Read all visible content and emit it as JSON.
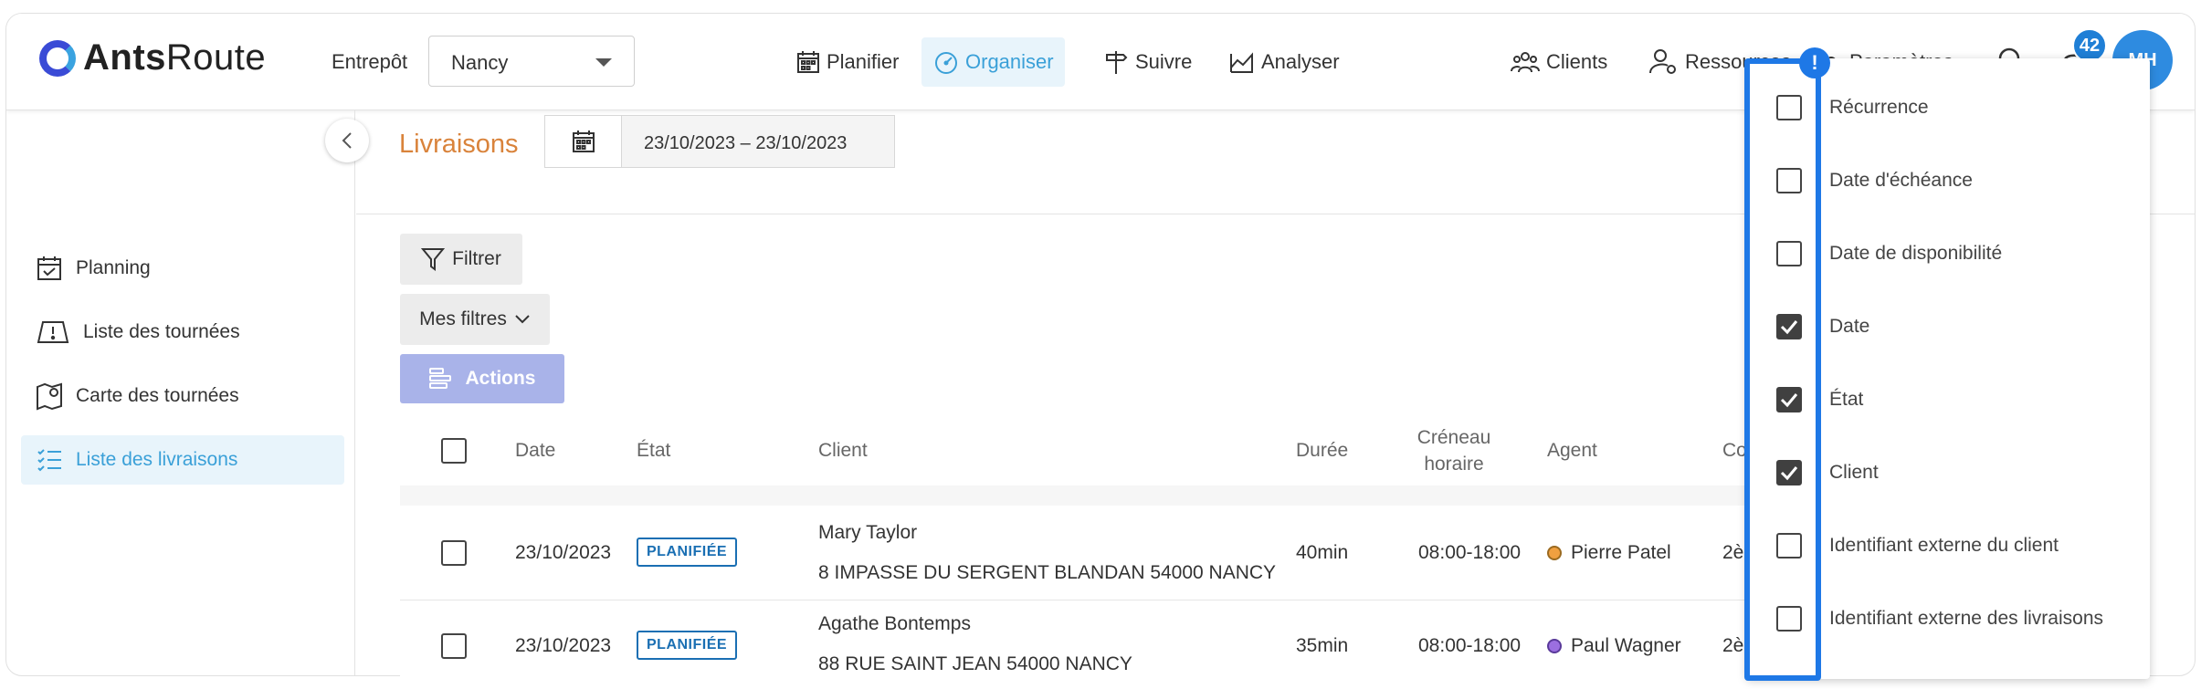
{
  "app": {
    "logo_bold": "Ants",
    "logo_rest": "Route"
  },
  "warehouse": {
    "label": "Entrepôt",
    "value": "Nancy"
  },
  "nav": {
    "planifier": "Planifier",
    "organiser": "Organiser",
    "suivre": "Suivre",
    "analyser": "Analyser",
    "clients": "Clients",
    "ressources": "Ressources",
    "parametres": "Paramètres"
  },
  "notifications": {
    "count": "42"
  },
  "user": {
    "initials": "MH"
  },
  "sidebar": {
    "items": [
      {
        "label": "Planning",
        "icon": "calendar-check-icon"
      },
      {
        "label": "Liste des tournées",
        "icon": "route-board-icon"
      },
      {
        "label": "Carte des tournées",
        "icon": "map-pin-icon"
      },
      {
        "label": "Liste des livraisons",
        "icon": "checklist-icon"
      }
    ]
  },
  "page": {
    "title": "Livraisons",
    "date_range": "23/10/2023 – 23/10/2023"
  },
  "toolbar": {
    "filter": "Filtrer",
    "my_filters": "Mes filtres",
    "actions": "Actions"
  },
  "table": {
    "headers": {
      "date": "Date",
      "etat": "État",
      "client": "Client",
      "duree": "Durée",
      "creneau_1": "Créneau",
      "creneau_2": "horaire",
      "agent": "Agent",
      "col_partial": "Co"
    },
    "rows": [
      {
        "date": "23/10/2023",
        "status": "PLANIFIÉE",
        "client_name": "Mary Taylor",
        "client_address": "8 IMPASSE DU SERGENT BLANDAN 54000 NANCY",
        "duration": "40min",
        "slot": "08:00-18:00",
        "agent": "Pierre Patel",
        "agent_color": "#f0a040",
        "partial": "2è"
      },
      {
        "date": "23/10/2023",
        "status": "PLANIFIÉE",
        "client_name": "Agathe Bontemps",
        "client_address": "88 RUE SAINT JEAN 54000 NANCY",
        "duration": "35min",
        "slot": "08:00-18:00",
        "agent": "Paul Wagner",
        "agent_color": "#9b6fe0",
        "partial": "2è"
      }
    ]
  },
  "column_chooser": {
    "items": [
      {
        "label": "Récurrence",
        "checked": false
      },
      {
        "label": "Date d'échéance",
        "checked": false
      },
      {
        "label": "Date de disponibilité",
        "checked": false
      },
      {
        "label": "Date",
        "checked": true
      },
      {
        "label": "État",
        "checked": true
      },
      {
        "label": "Client",
        "checked": true
      },
      {
        "label": "Identifiant externe du client",
        "checked": false
      },
      {
        "label": "Identifiant externe des livraisons",
        "checked": false
      }
    ],
    "alert_glyph": "!"
  },
  "colors": {
    "accent": "#3aa0d8",
    "title_orange": "#d9833b",
    "highlight": "#1e78e6",
    "actions_btn": "#a9b3e9"
  }
}
